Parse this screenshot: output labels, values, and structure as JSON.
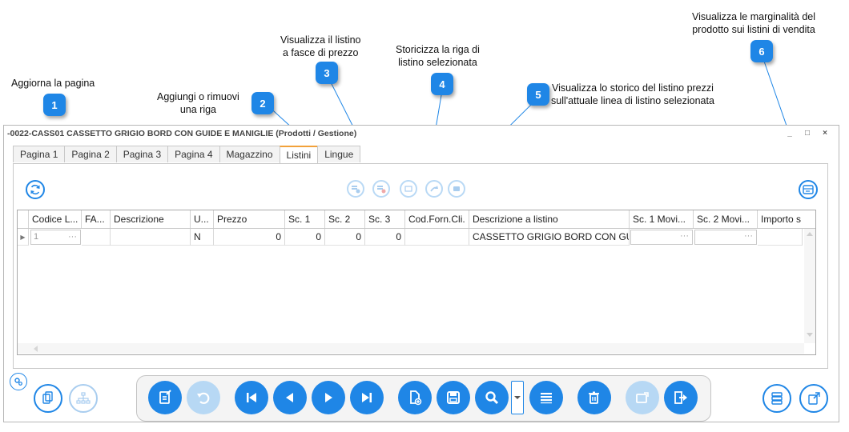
{
  "annotations": {
    "c1": {
      "num": "1",
      "text": "Aggiorna la pagina"
    },
    "c2": {
      "num": "2",
      "line1": "Aggiungi o rimuovi",
      "line2": "una riga"
    },
    "c3": {
      "num": "3",
      "line1": "Visualizza il listino",
      "line2": "a fasce di prezzo"
    },
    "c4": {
      "num": "4",
      "line1": "Storicizza la riga di",
      "line2": "listino selezionata"
    },
    "c5": {
      "num": "5",
      "line1": "Visualizza lo storico del listino prezzi",
      "line2": "sull'attuale linea di listino selezionata"
    },
    "c6": {
      "num": "6",
      "line1": "Visualizza le marginalità del",
      "line2": "prodotto sui listini di vendita"
    }
  },
  "window": {
    "title": "-0022-CASS01 CASSETTO GRIGIO BORD CON GUIDE E MANIGLIE (Prodotti / Gestione)",
    "minimize": "_",
    "maximize": "□",
    "close": "×"
  },
  "tabs": [
    "Pagina 1",
    "Pagina 2",
    "Pagina 3",
    "Pagina 4",
    "Magazzino",
    "Listini",
    "Lingue"
  ],
  "active_tab": "Listini",
  "grid": {
    "headers": [
      "Codice L...",
      "FA...",
      "Descrizione",
      "U...",
      "Prezzo",
      "Sc. 1",
      "Sc. 2",
      "Sc. 3",
      "Cod.Forn.Cli.",
      "Descrizione a listino",
      "Sc. 1 Movi...",
      "Sc. 2 Movi...",
      "Importo s"
    ],
    "row": {
      "codice": "1",
      "fa": "",
      "descrizione": "",
      "u": "N",
      "prezzo": "0",
      "sc1": "0",
      "sc2": "0",
      "sc3": "0",
      "cod_forn": "",
      "descrizione_listino": "CASSETTO GRIGIO BORD CON GU...",
      "sc1_movi": "",
      "sc2_movi": "",
      "importo": ""
    },
    "ellipsis": "···"
  },
  "icons": {
    "refresh": "refresh-icon",
    "add_row": "add-row-icon",
    "remove_row": "remove-row-icon",
    "price_bands": "price-bands-icon",
    "historicize": "historicize-icon",
    "history": "history-icon",
    "margins": "margins-icon"
  },
  "colors": {
    "accent": "#1f86e6",
    "disabled": "#b7d8f4",
    "tab_active": "#f2a13a"
  }
}
